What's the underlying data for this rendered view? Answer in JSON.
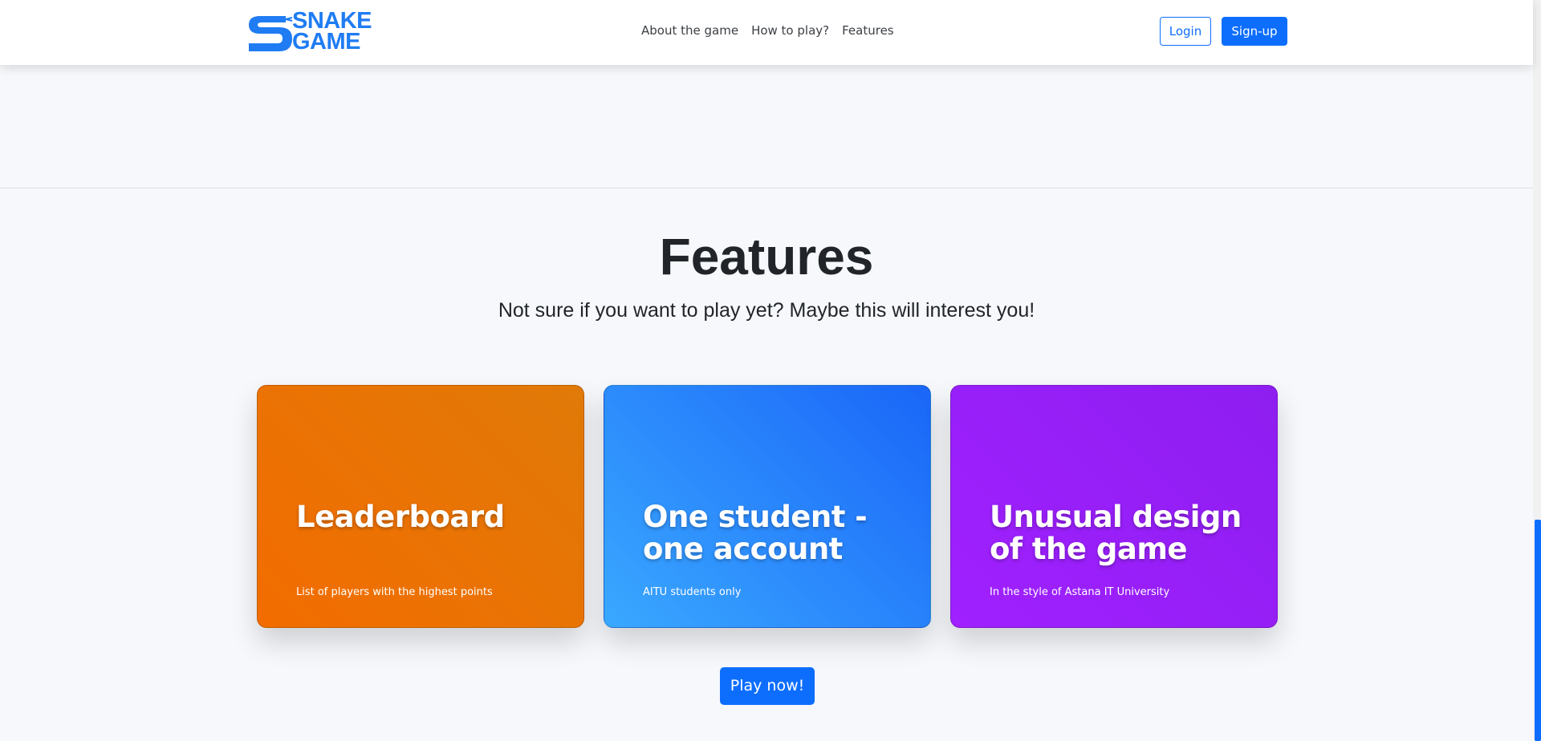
{
  "brand": {
    "line1": "SNAKE",
    "line2": "GAME",
    "color": "#1f7cf3"
  },
  "nav": {
    "links": [
      "About the game",
      "How to play?",
      "Features"
    ]
  },
  "auth": {
    "login_label": "Login",
    "signup_label": "Sign-up"
  },
  "features": {
    "title": "Features",
    "subtitle": "Not sure if you want to play yet? Maybe this will interest you!",
    "cards": [
      {
        "title": "Leaderboard",
        "text": "List of players with the highest points",
        "color": "#f36c00"
      },
      {
        "title": "One student - one account",
        "text": "AITU students only",
        "color": "#2a8cff"
      },
      {
        "title": "Unusual design of the game",
        "text": "In the style of Astana IT University",
        "color": "#9a20ff"
      }
    ],
    "play_label": "Play now!"
  },
  "colors": {
    "primary": "#0d6efd",
    "background": "#f6f8fb"
  }
}
